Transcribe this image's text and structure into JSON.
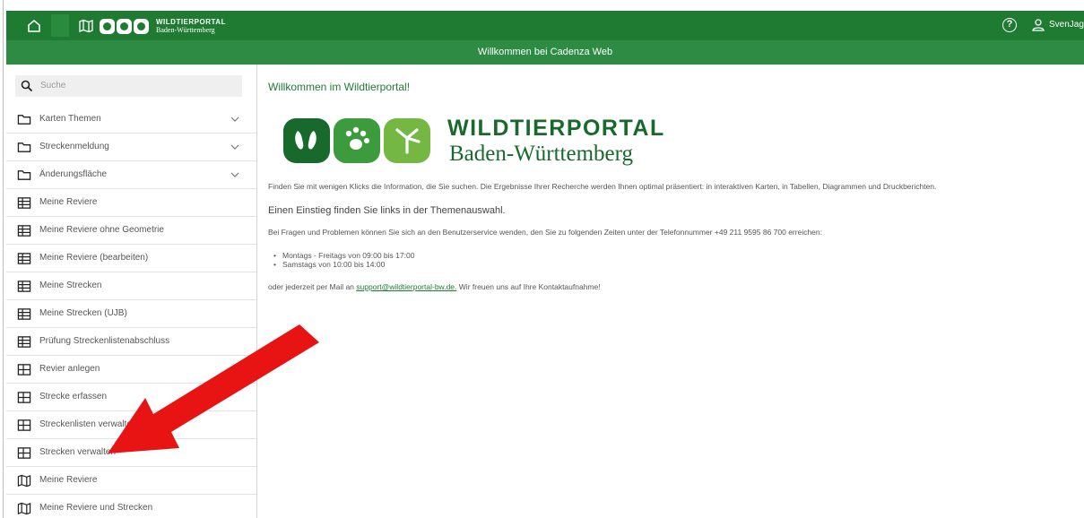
{
  "header": {
    "logo_line1": "WILDTIERPORTAL",
    "logo_line2": "Baden-Württemberg",
    "username": "SvenJage",
    "bg_color": "#1f7a32"
  },
  "welcome_bar": {
    "text": "Willkommen bei Cadenza Web"
  },
  "sidebar": {
    "search_placeholder": "Suche",
    "items": [
      {
        "label": "Karten Themen",
        "icon": "folder-icon",
        "expandable": true
      },
      {
        "label": "Streckenmeldung",
        "icon": "folder-icon",
        "expandable": true
      },
      {
        "label": "Änderungsfläche",
        "icon": "folder-icon",
        "expandable": true
      },
      {
        "label": "Meine Reviere",
        "icon": "table-icon"
      },
      {
        "label": "Meine Reviere ohne Geometrie",
        "icon": "table-icon"
      },
      {
        "label": "Meine Reviere (bearbeiten)",
        "icon": "table-icon"
      },
      {
        "label": "Meine Strecken",
        "icon": "table-icon"
      },
      {
        "label": "Meine Strecken (UJB)",
        "icon": "table-icon"
      },
      {
        "label": "Prüfung Streckenlistenabschluss",
        "icon": "table-icon"
      },
      {
        "label": "Revier anlegen",
        "icon": "form-icon"
      },
      {
        "label": "Strecke erfassen",
        "icon": "form-icon"
      },
      {
        "label": "Streckenlisten verwalten",
        "icon": "form-icon"
      },
      {
        "label": "Strecken verwalten",
        "icon": "form-icon"
      },
      {
        "label": "Meine Reviere",
        "icon": "map-icon"
      },
      {
        "label": "Meine Reviere und Strecken",
        "icon": "map-icon"
      }
    ]
  },
  "content": {
    "title": "Willkommen im Wildtierportal!",
    "logo_line1": "WILDTIERPORTAL",
    "logo_line2": "Baden-Württemberg",
    "intro": "Finden Sie mit wenigen Klicks die Information, die Sie suchen. Die Ergebnisse Ihrer Recherche werden Ihnen optimal präsentiert: in interaktiven Karten, in Tabellen, Diagrammen und Druckberichten.",
    "heading": "Einen Einstieg finden Sie links in der Themenauswahl.",
    "support_text": "Bei Fragen und Problemen können Sie sich an den Benutzerservice wenden, den Sie zu folgenden Zeiten unter der Telefonnummer +49 211 9595 86 700 erreichen:",
    "hours": [
      "Montags - Freitags von 09:00 bis 17:00",
      "Samstags von 10:00 bis 14:00"
    ],
    "mail_prefix": "oder jederzeit per Mail an",
    "mail_link": "support@wildtierportal-bw.de.",
    "mail_suffix": "Wir freuen uns auf Ihre Kontaktaufnahme!"
  },
  "colors": {
    "brand_green": "#1f7a32",
    "welcome_green": "#2d8b43",
    "arrow_red": "#e81414"
  }
}
